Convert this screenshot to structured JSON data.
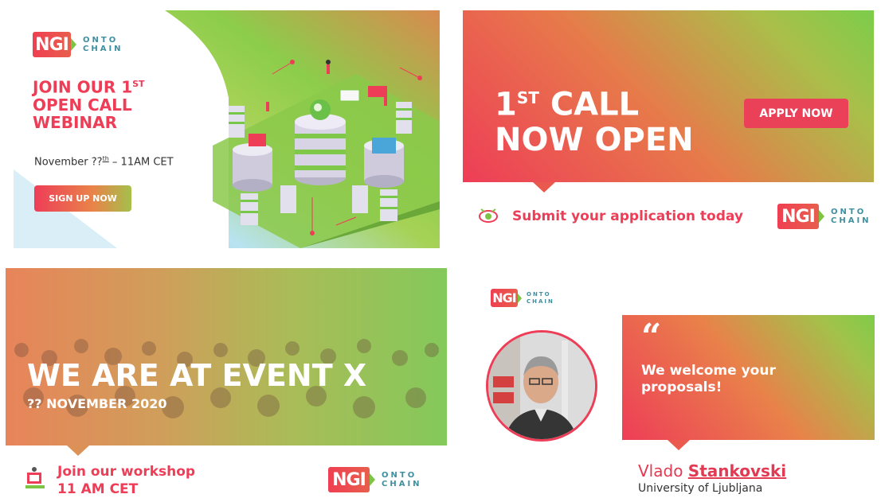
{
  "logo": {
    "box": "NGI",
    "line1": "ONTO",
    "line2": "CHAIN"
  },
  "card1": {
    "title_line1": "JOIN OUR 1",
    "title_sup": "ST",
    "title_line2": "OPEN CALL",
    "title_line3": "WEBINAR",
    "date_prefix": "November ??",
    "date_sup": "th",
    "date_suffix": " – 11AM CET",
    "button": "SIGN UP NOW"
  },
  "card2": {
    "title_a": "1",
    "title_sup": "ST",
    "title_b": " CALL",
    "title_line2": "NOW OPEN",
    "button": "APPLY NOW",
    "footer": "Submit your application today"
  },
  "card3": {
    "title": "WE ARE AT EVENT X",
    "subtitle": "?? NOVEMBER 2020",
    "footer_line1": "Join our workshop",
    "footer_line2": "11 AM CET"
  },
  "card4": {
    "quote_mark": "“",
    "quote_line1": "We welcome your",
    "quote_line2": "proposals!",
    "first_name": "Vlado",
    "last_name": "Stankovski",
    "affiliation": "University of Ljubljana"
  },
  "colors": {
    "brand_red": "#ee3d57",
    "brand_green": "#7cc544",
    "brand_teal": "#3f8fa0"
  }
}
